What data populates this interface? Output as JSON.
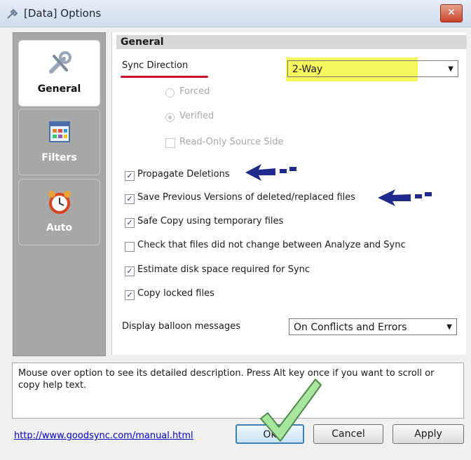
{
  "window": {
    "title": "[Data] Options",
    "close_label": "✕"
  },
  "sidebar": {
    "items": [
      {
        "label": "General",
        "icon": "wrench-icon"
      },
      {
        "label": "Filters",
        "icon": "grid-icon"
      },
      {
        "label": "Auto",
        "icon": "alarm-clock-icon"
      }
    ]
  },
  "panel": {
    "header": "General",
    "sync_direction": {
      "label": "Sync Direction",
      "value": "2-Way"
    },
    "radios": [
      {
        "label": "Forced",
        "selected": false
      },
      {
        "label": "Verified",
        "selected": true
      }
    ],
    "readonly_source": {
      "label": "Read-Only Source Side",
      "checked": false
    },
    "options": [
      {
        "label": "Propagate Deletions",
        "checked": true
      },
      {
        "label": "Save Previous Versions of deleted/replaced files",
        "checked": true
      },
      {
        "label": "Safe Copy using temporary files",
        "checked": true
      },
      {
        "label": "Check that files did not change between Analyze and Sync",
        "checked": false
      },
      {
        "label": "Estimate disk space required for Sync",
        "checked": true
      },
      {
        "label": "Copy locked files",
        "checked": true
      }
    ],
    "balloon": {
      "label": "Display balloon messages",
      "value": "On Conflicts and Errors"
    }
  },
  "help_text": "Mouse over option to see its detailed description. Press Alt key once if you want to scroll or copy help text.",
  "footer": {
    "link": "http://www.goodsync.com/manual.html",
    "ok": "Ok",
    "cancel": "Cancel",
    "apply": "Apply"
  },
  "colors": {
    "highlight": "#f5f542",
    "annotation_arrow": "#1f2b8c",
    "underline": "#c8102e",
    "checkmark": "#a8e6a0"
  }
}
